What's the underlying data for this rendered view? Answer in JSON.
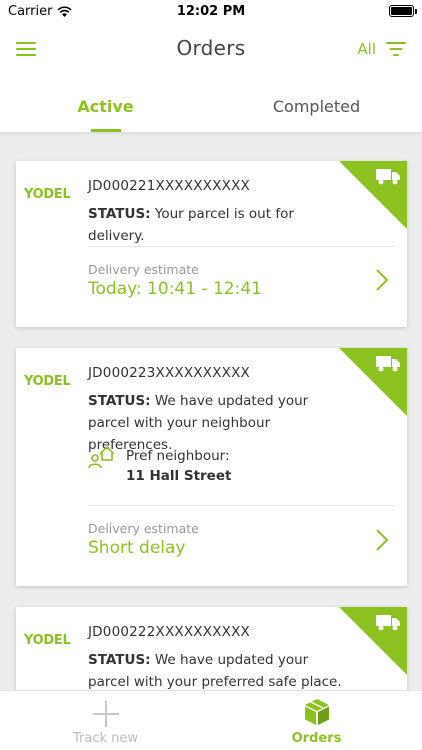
{
  "status_bar": {
    "carrier": "Carrier",
    "time": "12:02 PM"
  },
  "header": {
    "title": "Orders",
    "filter_label": "All"
  },
  "tabs": [
    {
      "label": "Active"
    },
    {
      "label": "Completed"
    }
  ],
  "orders": [
    {
      "courier": "YODEL",
      "tracking": "JD000221XXXXXXXXXX",
      "status_label": "STATUS:",
      "status_text": "Your parcel is out for delivery.",
      "estimate_label": "Delivery estimate",
      "estimate_value": "Today: 10:41 - 12:41"
    },
    {
      "courier": "YODEL",
      "tracking": "JD000223XXXXXXXXXX",
      "status_label": "STATUS:",
      "status_text": "We have updated your parcel with your neighbour preferences.",
      "pref_label": "Pref neighbour:",
      "pref_value": "11 Hall Street",
      "estimate_label": "Delivery estimate",
      "estimate_value": "Short delay"
    },
    {
      "courier": "YODEL",
      "tracking": "JD000222XXXXXXXXXX",
      "status_label": "STATUS:",
      "status_text": "We have updated your parcel with your preferred safe place."
    }
  ],
  "bottom_nav": {
    "track_new": "Track new",
    "orders": "Orders"
  },
  "colors": {
    "accent": "#8cc21f",
    "background": "#ededed"
  }
}
